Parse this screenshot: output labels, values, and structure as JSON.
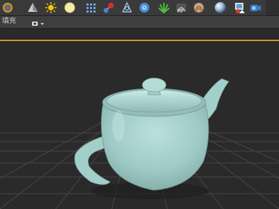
{
  "toolbar": {
    "icons": [
      "cone-icon",
      "pyramid-icon",
      "sun-light-icon",
      "sphere-light-icon",
      "particle-grid-icon",
      "molecule-icon",
      "bone-system-icon",
      "gear-settings-icon",
      "plant-icon",
      "hf-icon",
      "hair-fur-icon",
      "sphere-material-icon",
      "scene-icon",
      "camera-icon"
    ],
    "hf_label": "HF"
  },
  "subbar": {
    "fill_label": "填充",
    "display_icon": "camera-dropdown-icon"
  },
  "viewport": {
    "object": "teapot",
    "colors": {
      "background": "#2a2a2a",
      "grid": "#474747",
      "teapot": "#a7d2cd",
      "active_border": "#c89a2a"
    }
  }
}
